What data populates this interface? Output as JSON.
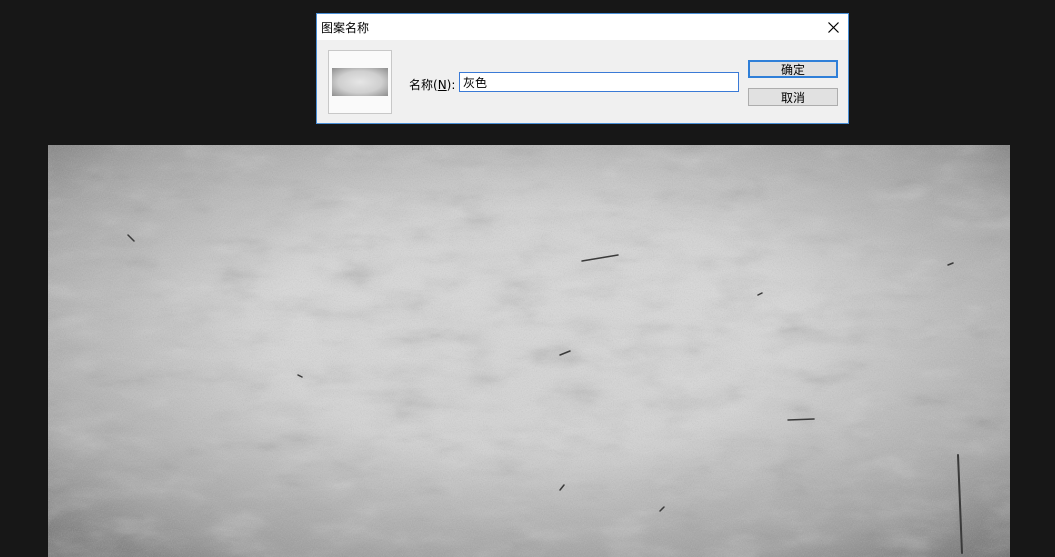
{
  "dialog": {
    "title": "图案名称",
    "name_label": "名称(",
    "name_label_mnemonic": "N",
    "name_label_suffix": "):",
    "name_value": "灰色",
    "ok_label": "确定",
    "cancel_label": "取消",
    "close_icon": "close-icon"
  },
  "colors": {
    "background": "#171717",
    "dialog_border": "#4a8fd6",
    "focus_blue": "#2f7fd8"
  }
}
